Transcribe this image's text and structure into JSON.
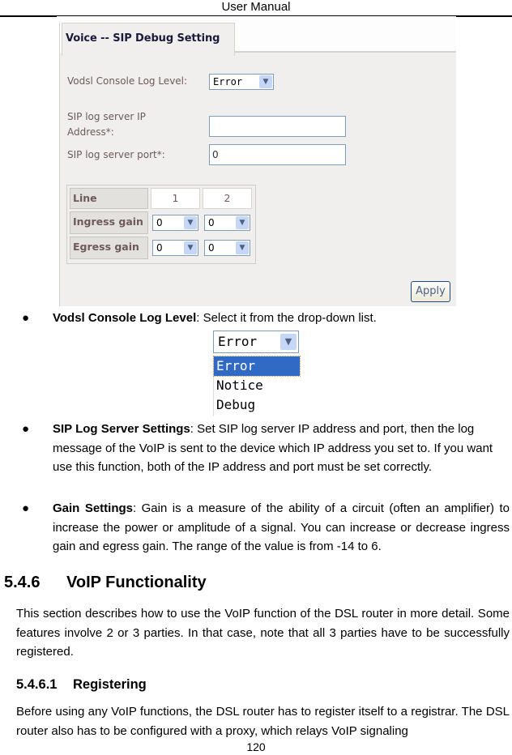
{
  "header": {
    "title": "User Manual"
  },
  "screenshot": {
    "tab_title": "Voice -- SIP Debug Setting",
    "console_log_level": {
      "label": "Vodsl Console Log Level:",
      "value": "Error"
    },
    "ip_address": {
      "label_line1": "SIP log server IP",
      "label_line2": "Address*:",
      "value": ""
    },
    "port": {
      "label": "SIP log server port*:",
      "value": "0"
    },
    "gain_table": {
      "header_label": "Line",
      "lines": [
        "1",
        "2"
      ],
      "rows": [
        {
          "label": "Ingress gain",
          "values": [
            "0",
            "0"
          ]
        },
        {
          "label": "Egress gain",
          "values": [
            "0",
            "0"
          ]
        }
      ]
    },
    "apply_label": "Apply"
  },
  "bullets": [
    {
      "term": "Vodsl Console Log Level",
      "text": ": Select it from the drop-down list."
    },
    {
      "term": "SIP Log Server Settings",
      "text": ": Set SIP log server IP address and port, then the log message of the VoIP is sent to the device which IP address you set to. If you want use this function, both of the IP address and port must be set correctly."
    },
    {
      "term": "Gain Settings",
      "text": ": Gain is a measure of the ability of a circuit (often an amplifier) to increase the power or amplitude of a signal. You can increase or decrease ingress gain and egress gain. The range of the value is from -14 to 6."
    }
  ],
  "dropdown_illustration": {
    "selected": "Error",
    "options": [
      "Error",
      "Notice",
      "Debug"
    ]
  },
  "section": {
    "number": "5.4.6",
    "title": "VoIP Functionality",
    "body": "This section describes how to use the VoIP function of the DSL router in more detail. Some features involve 2 or 3 parties. In that case, note that all 3 parties have to be successfully registered."
  },
  "subsection": {
    "number": "5.4.6.1",
    "title": "Registering",
    "body": "Before using any VoIP functions, the DSL router has to register itself to a registrar. The DSL router also has to be configured with a proxy, which relays VoIP signaling"
  },
  "page_number": "120",
  "colors": {
    "selection": "#316ac5",
    "label_text": "#6e5a5a",
    "panel_bg": "#f0efed"
  }
}
